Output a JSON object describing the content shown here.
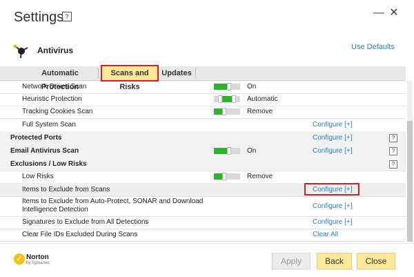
{
  "header": {
    "title": "Settings",
    "help_glyph": "?",
    "minimize_glyph": "—",
    "close_glyph": "✕",
    "section_title": "Antivirus",
    "use_defaults": "Use Defaults"
  },
  "tabs": [
    {
      "label": "Automatic Protection",
      "active": false
    },
    {
      "label": "Scans and Risks",
      "active": true
    },
    {
      "label": "Updates",
      "active": false
    }
  ],
  "rows": [
    {
      "label": "Network Drives Scan",
      "status": "On"
    },
    {
      "label": "Heuristic Protection",
      "status": "Automatic"
    },
    {
      "label": "Tracking Cookies Scan",
      "status": "Remove"
    },
    {
      "label": "Full System Scan",
      "link": "Configure [+]"
    },
    {
      "label": "Protected Ports",
      "link": "Configure [+]",
      "help": "?"
    },
    {
      "label": "Email Antivirus Scan",
      "status": "On",
      "link": "Configure [+]",
      "help": "?"
    },
    {
      "label": "Exclusions / Low Risks",
      "help": "?"
    },
    {
      "label": "Low Risks",
      "status": "Remove"
    },
    {
      "label": "Items to Exclude from Scans",
      "link": "Configure [+]"
    },
    {
      "label": "Items to Exclude from Auto-Protect, SONAR and Download",
      "label2": "Intelligence Detection",
      "link": "Configure [+]"
    },
    {
      "label": "Signatures to Exclude from All Detections",
      "link": "Configure [+]"
    },
    {
      "label": "Clear File IDs Excluded During Scans",
      "link": "Clear All"
    }
  ],
  "footer": {
    "brand": "Norton",
    "brand_sub": "by Symantec",
    "brand_glyph": "✓",
    "apply": "Apply",
    "back": "Back",
    "close": "Close"
  },
  "colors": {
    "accent_link": "#2f7fc1",
    "toggle_on": "#2ab52a",
    "button_yellow": "#ffe89a",
    "highlight_outline": "#d0202a"
  }
}
